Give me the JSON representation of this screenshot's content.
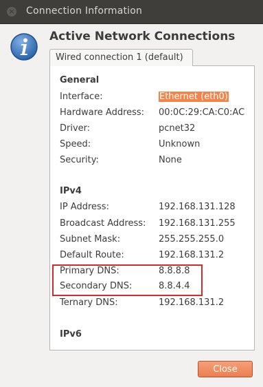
{
  "window": {
    "title": "Connection Information",
    "close_icon": "close-icon"
  },
  "header": {
    "icon": "info-icon",
    "title": "Active Network Connections"
  },
  "tab": {
    "label": "Wired connection 1 (default)"
  },
  "general": {
    "section_label": "General",
    "interface_label": "Interface:",
    "interface_value": "Ethernet (eth0)",
    "hardware_label": "Hardware Address:",
    "hardware_value": "00:0C:29:CA:C0:AC",
    "driver_label": "Driver:",
    "driver_value": "pcnet32",
    "speed_label": "Speed:",
    "speed_value": "Unknown",
    "security_label": "Security:",
    "security_value": "None"
  },
  "ipv4": {
    "section_label": "IPv4",
    "ip_label": "IP Address:",
    "ip_value": "192.168.131.128",
    "broadcast_label": "Broadcast Address:",
    "broadcast_value": "192.168.131.255",
    "subnet_label": "Subnet Mask:",
    "subnet_value": "255.255.255.0",
    "route_label": "Default Route:",
    "route_value": "192.168.131.2",
    "primary_dns_label": "Primary DNS:",
    "primary_dns_value": "8.8.8.8",
    "secondary_dns_label": "Secondary DNS:",
    "secondary_dns_value": "8.8.4.4",
    "ternary_dns_label": "Ternary DNS:",
    "ternary_dns_value": "192.168.131.2"
  },
  "ipv6": {
    "section_label": "IPv6"
  },
  "footer": {
    "close_label": "Close"
  },
  "colors": {
    "highlight": "#f2844a",
    "annotation_box": "#d42a2a",
    "titlebar": "#3f3e3a"
  }
}
